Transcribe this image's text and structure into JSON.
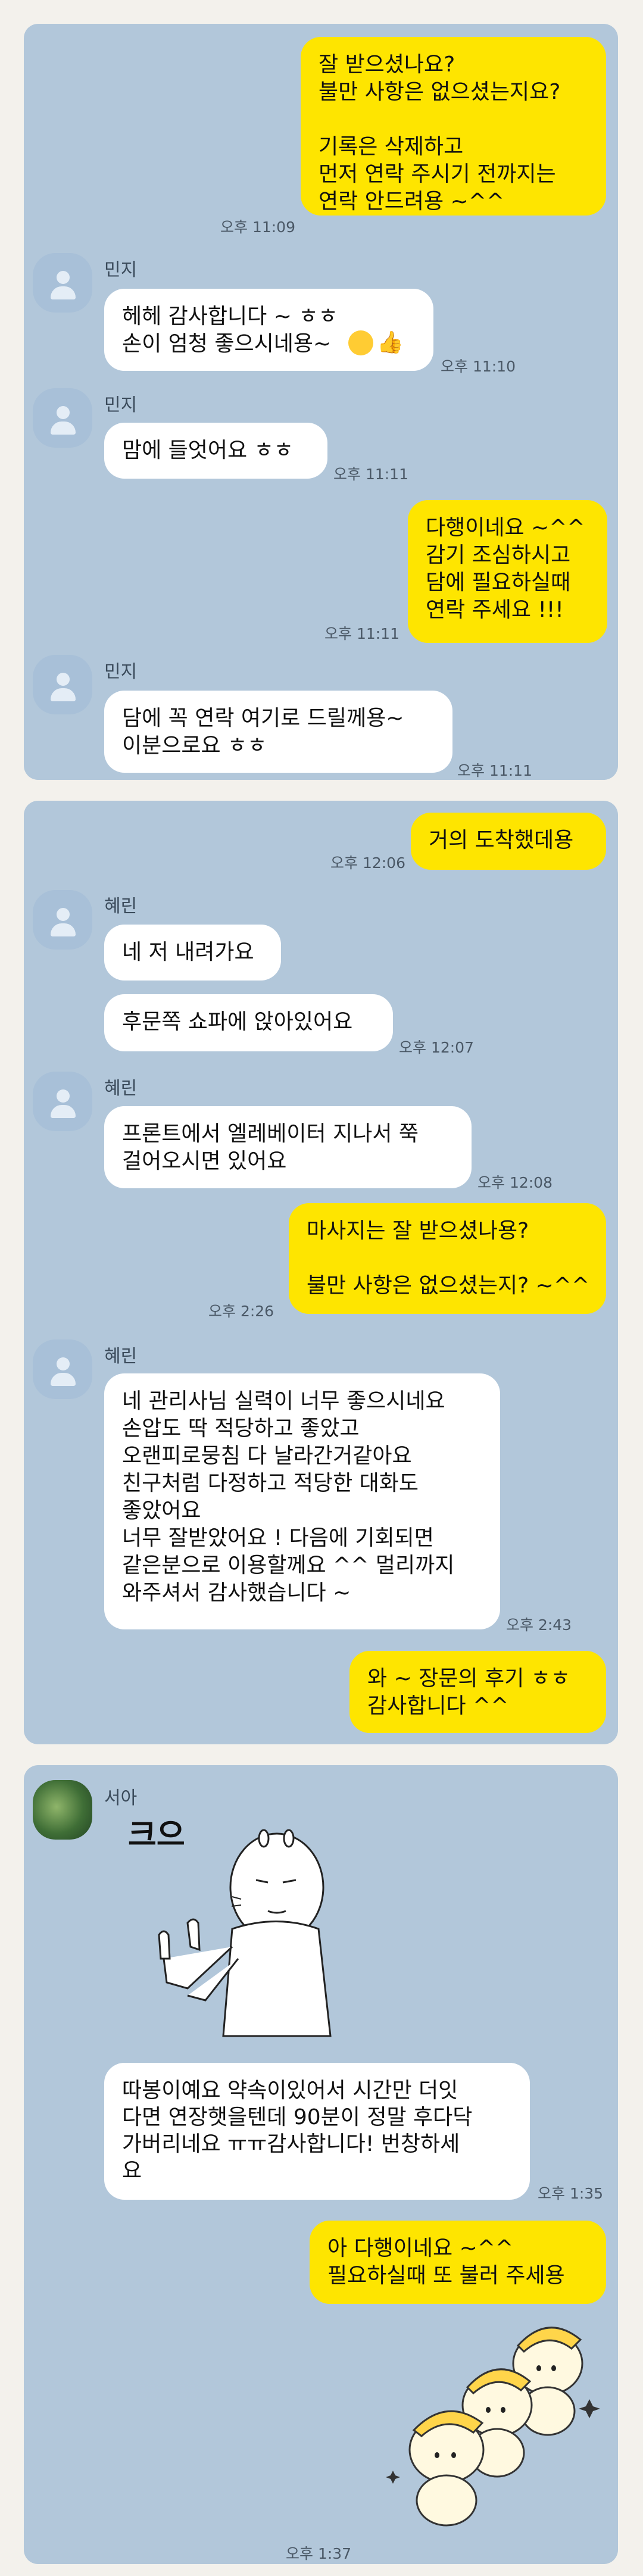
{
  "chat_panel_1": {
    "messages": [
      {
        "from": "me",
        "text": "잘 받으셨나요?\n불만 사항은 없으셨는지요?\n\n기록은 삭제하고\n먼저 연락 주시기 전까지는\n연락 안드려용 ~^^",
        "time": "오후 11:09"
      },
      {
        "from": "민지",
        "text": "헤헤 감사합니다 ~ ㅎㅎ\n손이 엄청 좋으시네용~",
        "time": "오후 11:10"
      },
      {
        "from": "민지",
        "text": "맘에 들엇어요 ㅎㅎ",
        "time": "오후 11:11"
      },
      {
        "from": "me",
        "text": "다행이네요 ~^^\n감기 조심하시고\n담에 필요하실때\n연락 주세요 !!!",
        "time": "오후 11:11"
      },
      {
        "from": "민지",
        "text": "담에 꼭 연락 여기로 드릴께용~\n이분으로요 ㅎㅎ",
        "time": "오후 11:11"
      }
    ]
  },
  "chat_panel_2": {
    "messages": [
      {
        "from": "me",
        "text": "거의 도착했데용",
        "time": "오후 12:06"
      },
      {
        "from": "혜린",
        "text": "네 저 내려가요"
      },
      {
        "from": "혜린",
        "text": "후문쪽 쇼파에 앉아있어요",
        "time": "오후 12:07"
      },
      {
        "from": "혜린",
        "text": "프론트에서 엘레베이터 지나서 쭉\n걸어오시면 있어요",
        "time": "오후 12:08"
      },
      {
        "from": "me",
        "text": "마사지는 잘 받으셨나용?\n\n불만 사항은 없으셨는지? ~^^",
        "time": "오후 2:26"
      },
      {
        "from": "혜린",
        "text": "네 관리사님 실력이 너무 좋으시네요\n손압도 딱 적당하고 좋았고\n오랜피로뭉침 다 날라간거같아요\n친구처럼 다정하고 적당한 대화도\n좋았어요\n너무 잘받았어요 ! 다음에 기회되면\n같은분으로 이용할께요 ^^ 멀리까지\n와주셔서 감사했습니다 ~",
        "time": "오후 2:43"
      },
      {
        "from": "me",
        "text": "와 ~ 장문의 후기 ㅎㅎ\n감사합니다 ^^"
      }
    ]
  },
  "chat_panel_3": {
    "messages": [
      {
        "from": "서아",
        "sticker_text": "크으",
        "text": "따봉이예요 약속이있어서 시간만 더잇\n다면 연장햇을텐데 90분이 정말 후다닥\n가버리네요 ㅠㅠ감사합니다! 번창하세\n요",
        "time": "오후 1:35"
      },
      {
        "from": "me",
        "text": "아 다행이네요 ~^^\n필요하실때 또 불러 주세용",
        "time": "오후 1:37"
      }
    ]
  },
  "colors": {
    "chat_background": "#b2c7da",
    "my_bubble": "#fee500",
    "their_bubble": "#ffffff",
    "page_background": "#f3f1ec"
  },
  "icons": [
    "default-avatar-icon",
    "profile-photo-avatar",
    "winking-emoji-icon",
    "thumbs-up-icon",
    "thumbs-up-character-sticker",
    "dancing-bunnies-sticker"
  ]
}
